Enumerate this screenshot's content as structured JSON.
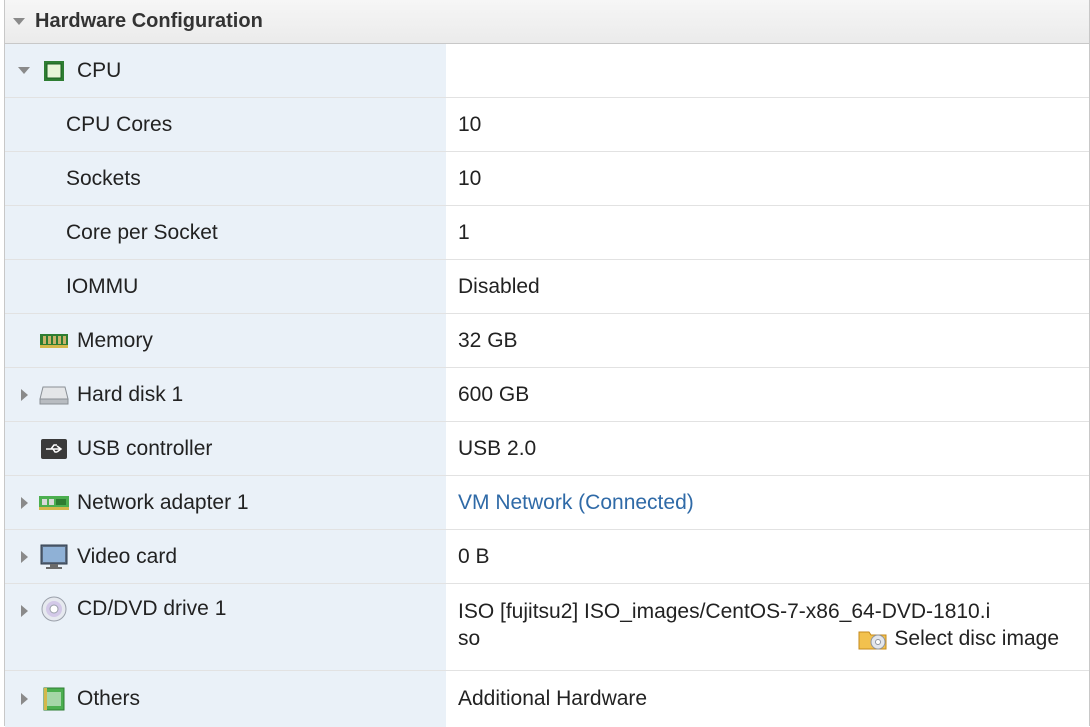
{
  "header": {
    "title": "Hardware Configuration"
  },
  "rows": {
    "cpu": {
      "label": "CPU",
      "value": ""
    },
    "cpu_cores": {
      "label": "CPU Cores",
      "value": "10"
    },
    "sockets": {
      "label": "Sockets",
      "value": "10"
    },
    "core_per_socket": {
      "label": "Core per Socket",
      "value": "1"
    },
    "iommu": {
      "label": "IOMMU",
      "value": "Disabled"
    },
    "memory": {
      "label": "Memory",
      "value": "32 GB"
    },
    "hard_disk": {
      "label": "Hard disk 1",
      "value": "600 GB"
    },
    "usb": {
      "label": "USB controller",
      "value": "USB 2.0"
    },
    "network": {
      "label": "Network adapter 1",
      "value": "VM Network (Connected)"
    },
    "video": {
      "label": "Video card",
      "value": "0 B"
    },
    "cdrom": {
      "label": "CD/DVD drive 1",
      "value_line1": "ISO [fujitsu2] ISO_images/CentOS-7-x86_64-DVD-1810.i",
      "value_line2": "so",
      "select_label": "Select disc image"
    },
    "others": {
      "label": "Others",
      "value": "Additional Hardware"
    }
  },
  "colors": {
    "label_bg": "#eaf1f8",
    "link": "#2f6aa7"
  },
  "icons": [
    "cpu-icon",
    "memory-icon",
    "hard-disk-icon",
    "usb-icon",
    "network-adapter-icon",
    "monitor-icon",
    "cd-dvd-icon",
    "folder-icon",
    "others-icon"
  ]
}
